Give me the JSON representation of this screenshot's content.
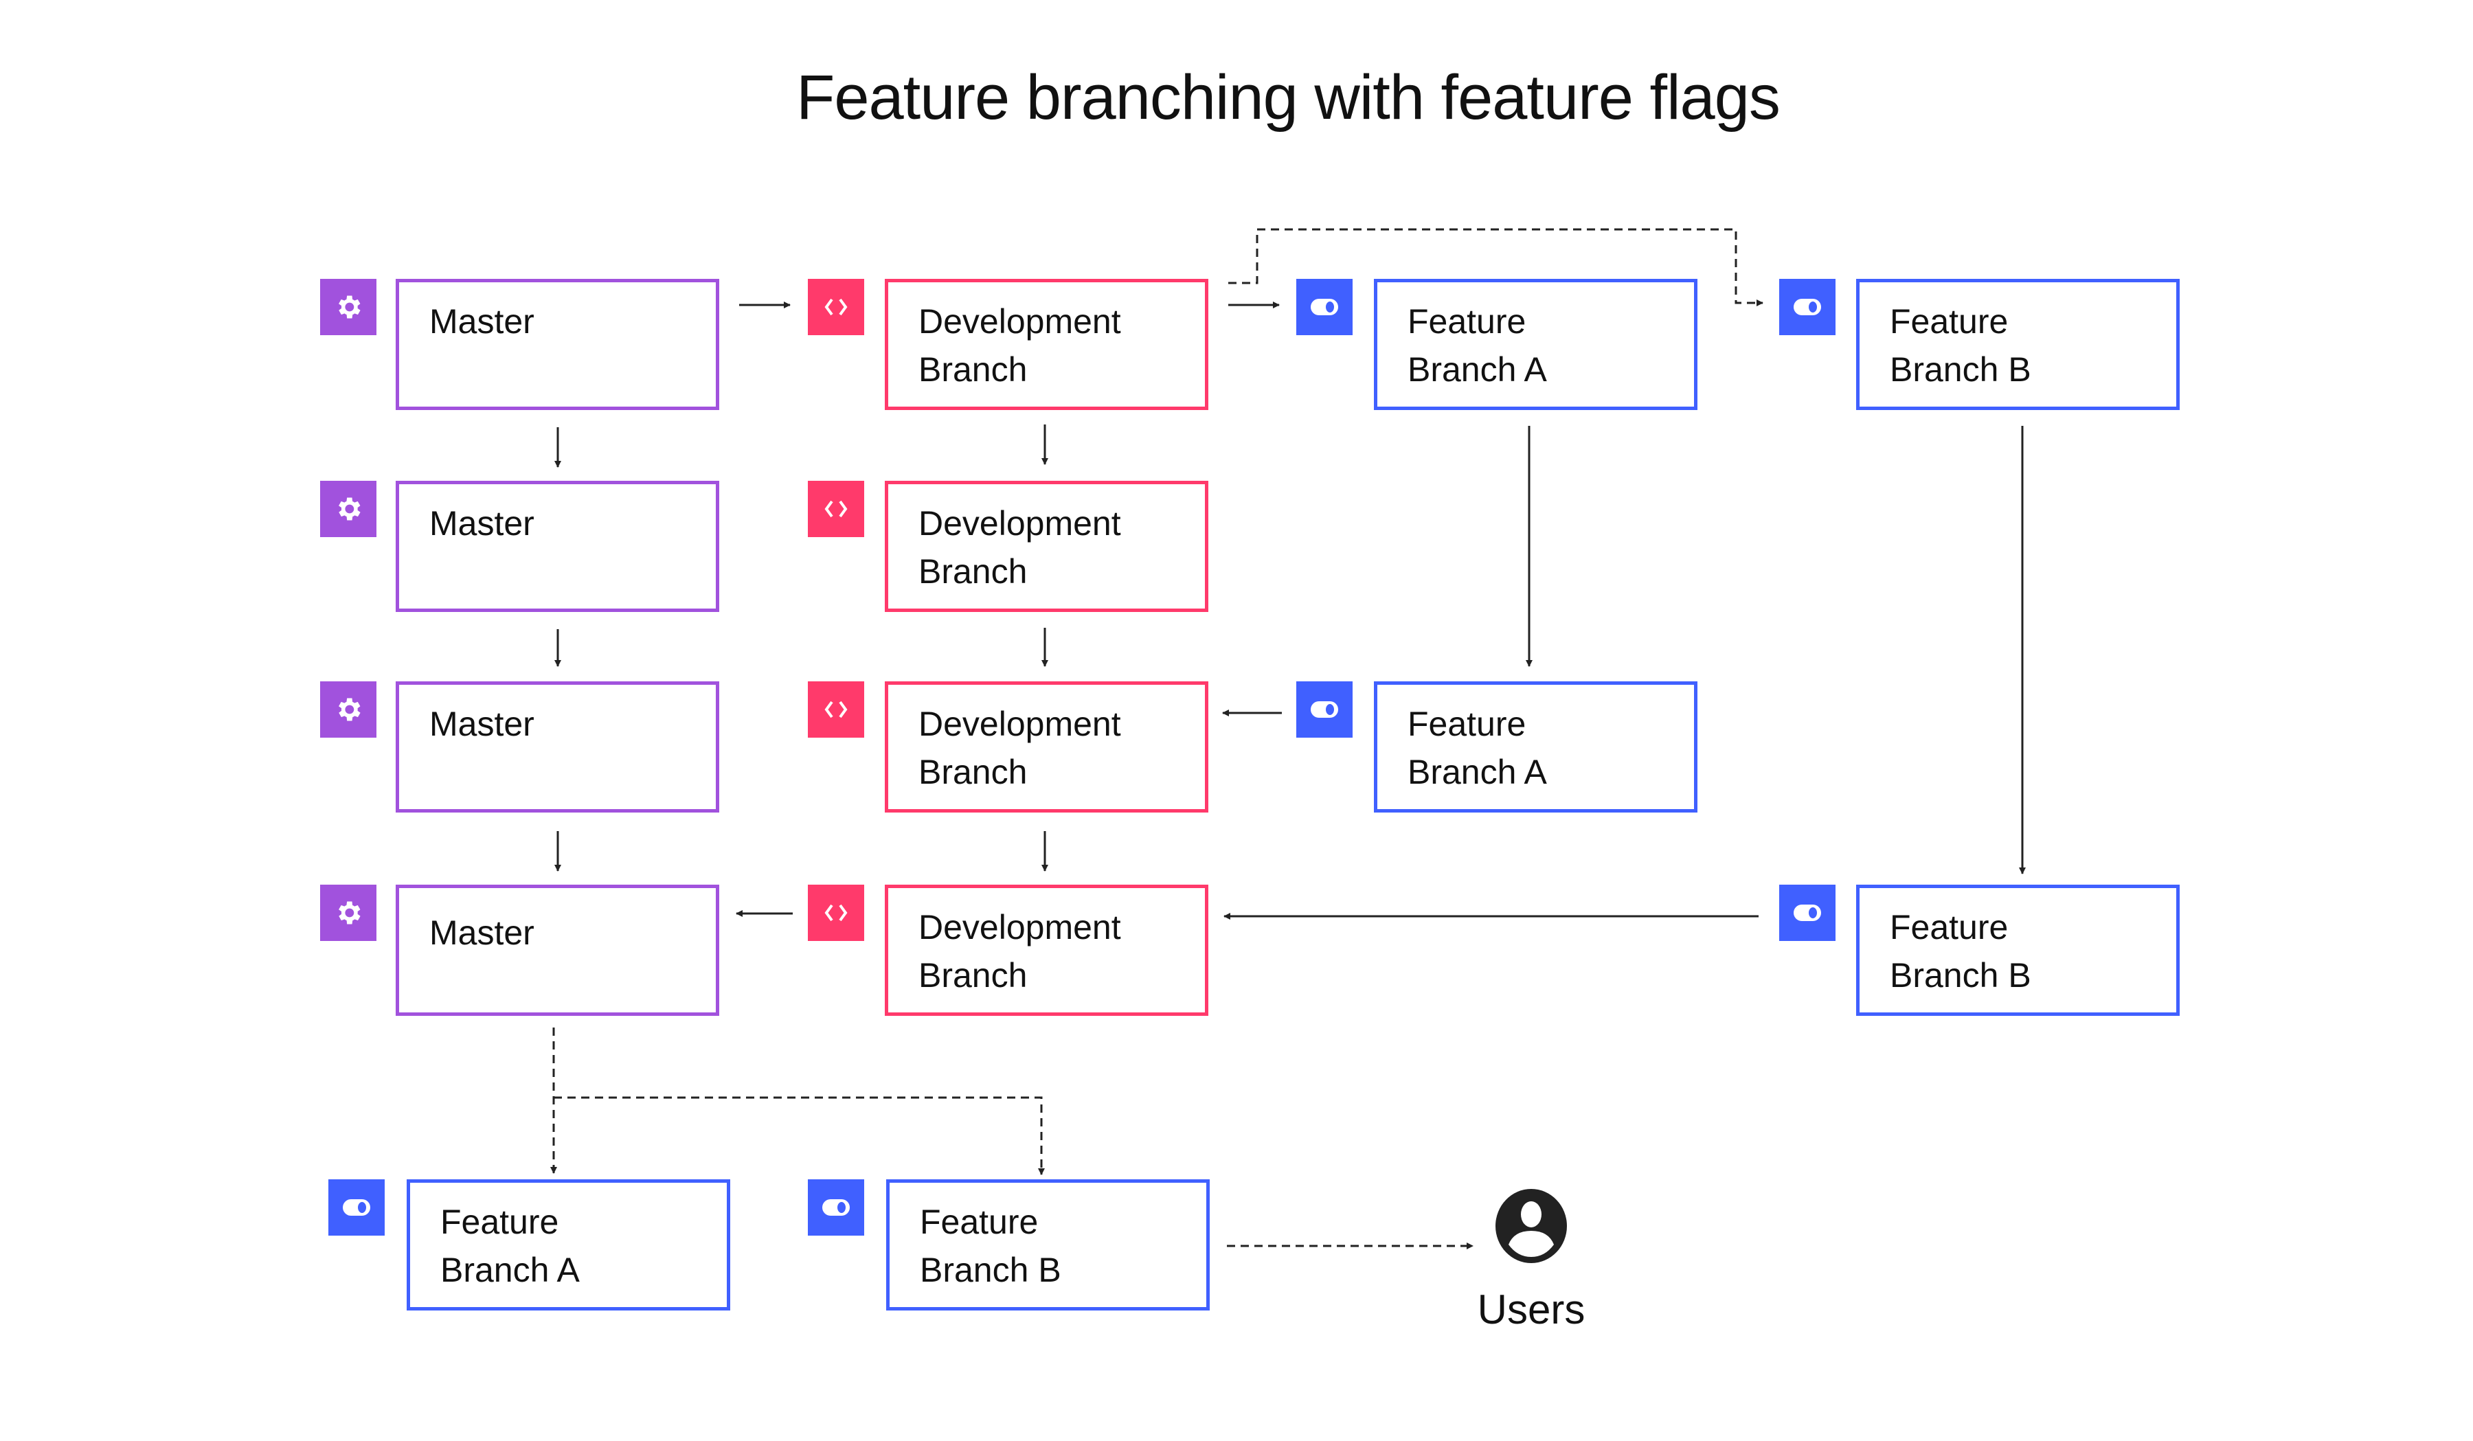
{
  "title": "Feature branching with feature flags",
  "colors": {
    "master": "#A152DD",
    "development": "#FF3A6B",
    "feature": "#4060FF",
    "line": "#222222"
  },
  "rows": [
    {
      "master": [
        "Master"
      ],
      "development": [
        "Development",
        "Branch"
      ],
      "feature_a": [
        "Feature",
        "Branch A"
      ],
      "feature_b": [
        "Feature",
        "Branch B"
      ]
    },
    {
      "master": [
        "Master"
      ],
      "development": [
        "Development",
        "Branch"
      ]
    },
    {
      "master": [
        "Master"
      ],
      "development": [
        "Development",
        "Branch"
      ],
      "feature_a": [
        "Feature",
        "Branch A"
      ]
    },
    {
      "master": [
        "Master"
      ],
      "development": [
        "Development",
        "Branch"
      ],
      "feature_b": [
        "Feature",
        "Branch B"
      ]
    }
  ],
  "release": {
    "feature_a": [
      "Feature",
      "Branch A"
    ],
    "feature_b": [
      "Feature",
      "Branch B"
    ],
    "users_label": "Users"
  },
  "icons": {
    "master": "gear-icon",
    "development": "code-brackets-icon",
    "feature": "toggle-icon",
    "users": "user-circle-icon"
  }
}
